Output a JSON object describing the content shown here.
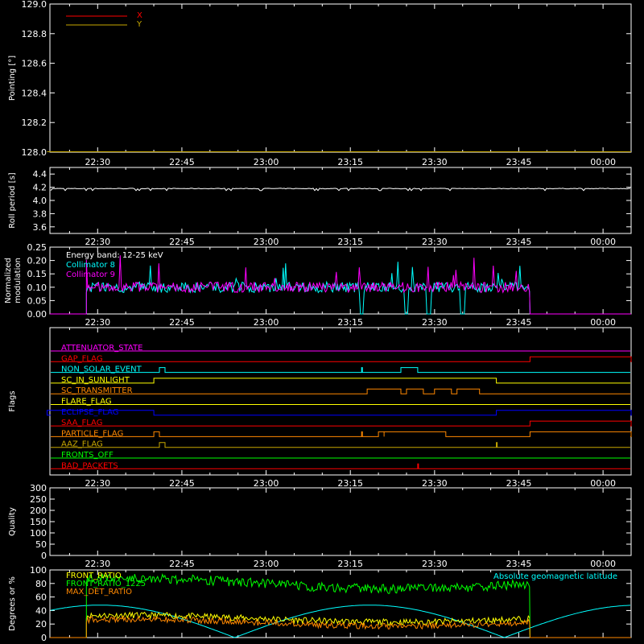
{
  "time_ticks": [
    "22:30",
    "22:45",
    "23:00",
    "23:15",
    "23:30",
    "23:45",
    "00:00"
  ],
  "chart_data": [
    {
      "id": "pointing",
      "type": "line",
      "ylabel": "Pointing [°]",
      "ylim": [
        128.0,
        129.0
      ],
      "yticks": [
        "128.0",
        "128.2",
        "128.4",
        "128.6",
        "128.8",
        "129.0"
      ],
      "legend": "top-left",
      "series": [
        {
          "name": "X",
          "color": "#ff0000",
          "y": []
        },
        {
          "name": "Y",
          "color": "#c8a800",
          "y": [
            {
              "t": "22:21",
              "v": 128.0
            },
            {
              "t": "00:05",
              "v": 128.0
            }
          ]
        }
      ]
    },
    {
      "id": "roll",
      "type": "line",
      "ylabel": "Roll period [s]",
      "ylim": [
        3.5,
        4.5
      ],
      "yticks": [
        "3.6",
        "3.8",
        "4.0",
        "4.2",
        "4.4"
      ],
      "series": [
        {
          "name": "",
          "color": "#ffffff",
          "y": [
            {
              "t": "22:21",
              "v": 4.18
            },
            {
              "t": "00:05",
              "v": 4.18
            }
          ]
        }
      ]
    },
    {
      "id": "modulation",
      "type": "line",
      "ylabel": [
        "Normalized",
        "modulation"
      ],
      "ylim": [
        0.0,
        0.25
      ],
      "yticks": [
        "0.00",
        "0.05",
        "0.10",
        "0.15",
        "0.20",
        "0.25"
      ],
      "annotation": "Energy band: 12-25 keV",
      "legend": "top-left",
      "series": [
        {
          "name": "Collimator 8",
          "color": "#00ffff",
          "start": "22:28",
          "end": "23:47",
          "level": 0.1
        },
        {
          "name": "Collimator 9",
          "color": "#ff00ff",
          "start": "22:28",
          "end": "23:47",
          "level": 0.1
        }
      ]
    },
    {
      "id": "flags",
      "type": "line",
      "ylabel": "Flags",
      "flags": [
        {
          "name": "ATTENUATOR_STATE",
          "color": "#ff00ff",
          "high": []
        },
        {
          "name": "GAP_FLAG",
          "color": "#ff0000",
          "high": [
            [
              "23:47",
              "00:05"
            ]
          ]
        },
        {
          "name": "NON_SOLAR_EVENT",
          "color": "#00ffff",
          "high": [
            [
              "22:41",
              "22:42"
            ],
            [
              "23:17",
              "23:17"
            ],
            [
              "23:24",
              "23:27"
            ]
          ]
        },
        {
          "name": "SC_IN_SUNLIGHT",
          "color": "#ffff00",
          "high": [
            [
              "22:40",
              "23:41"
            ]
          ]
        },
        {
          "name": "SC_TRANSMITTER",
          "color": "#ff8800",
          "high": [
            [
              "23:18",
              "23:24"
            ],
            [
              "23:25",
              "23:28"
            ],
            [
              "23:30",
              "23:33"
            ],
            [
              "23:34",
              "23:38"
            ]
          ]
        },
        {
          "name": "FLARE_FLAG",
          "color": "#ffff00",
          "high": []
        },
        {
          "name": "ECLIPSE_FLAG",
          "color": "#0000ff",
          "high": [
            [
              "22:21",
              "22:40"
            ],
            [
              "23:41",
              "00:05"
            ]
          ]
        },
        {
          "name": "SAA_FLAG",
          "color": "#ff0000",
          "high": [
            [
              "23:47",
              "00:05"
            ]
          ]
        },
        {
          "name": "PARTICLE_FLAG",
          "color": "#ff8800",
          "high": [
            [
              "22:40",
              "22:41"
            ],
            [
              "23:17",
              "23:17"
            ],
            [
              "23:20",
              "23:21"
            ],
            [
              "23:21",
              "23:32"
            ],
            [
              "23:47",
              "00:05"
            ]
          ]
        },
        {
          "name": "AAZ_FLAG",
          "color": "#c8a800",
          "high": [
            [
              "22:41",
              "22:42"
            ],
            [
              "23:41",
              "23:41"
            ]
          ]
        },
        {
          "name": "FRONTS_OFF",
          "color": "#00ff00",
          "high": []
        },
        {
          "name": "BAD_PACKETS",
          "color": "#ff0000",
          "high": [
            [
              "23:27",
              "23:27"
            ]
          ]
        }
      ]
    },
    {
      "id": "quality",
      "type": "line",
      "ylabel": "Quality",
      "ylim": [
        0,
        300
      ],
      "yticks": [
        "0",
        "50",
        "100",
        "150",
        "200",
        "250",
        "300"
      ],
      "series": []
    },
    {
      "id": "front",
      "type": "line",
      "ylabel": "Degrees or %",
      "ylim": [
        0,
        100
      ],
      "yticks": [
        "0",
        "20",
        "40",
        "60",
        "80",
        "100"
      ],
      "legend": "top-left",
      "series": [
        {
          "name": "FRONT_RATIO",
          "color": "#ffff00",
          "level": 28
        },
        {
          "name": "FRONT_RATIO_1225",
          "color": "#00ff00",
          "level": 80
        },
        {
          "name": "MAX_DET_RATIO",
          "color": "#ff8800",
          "level": 22
        },
        {
          "name": "Absolute geomagnetic latitude",
          "color": "#00ffff",
          "level": 40
        }
      ]
    }
  ]
}
